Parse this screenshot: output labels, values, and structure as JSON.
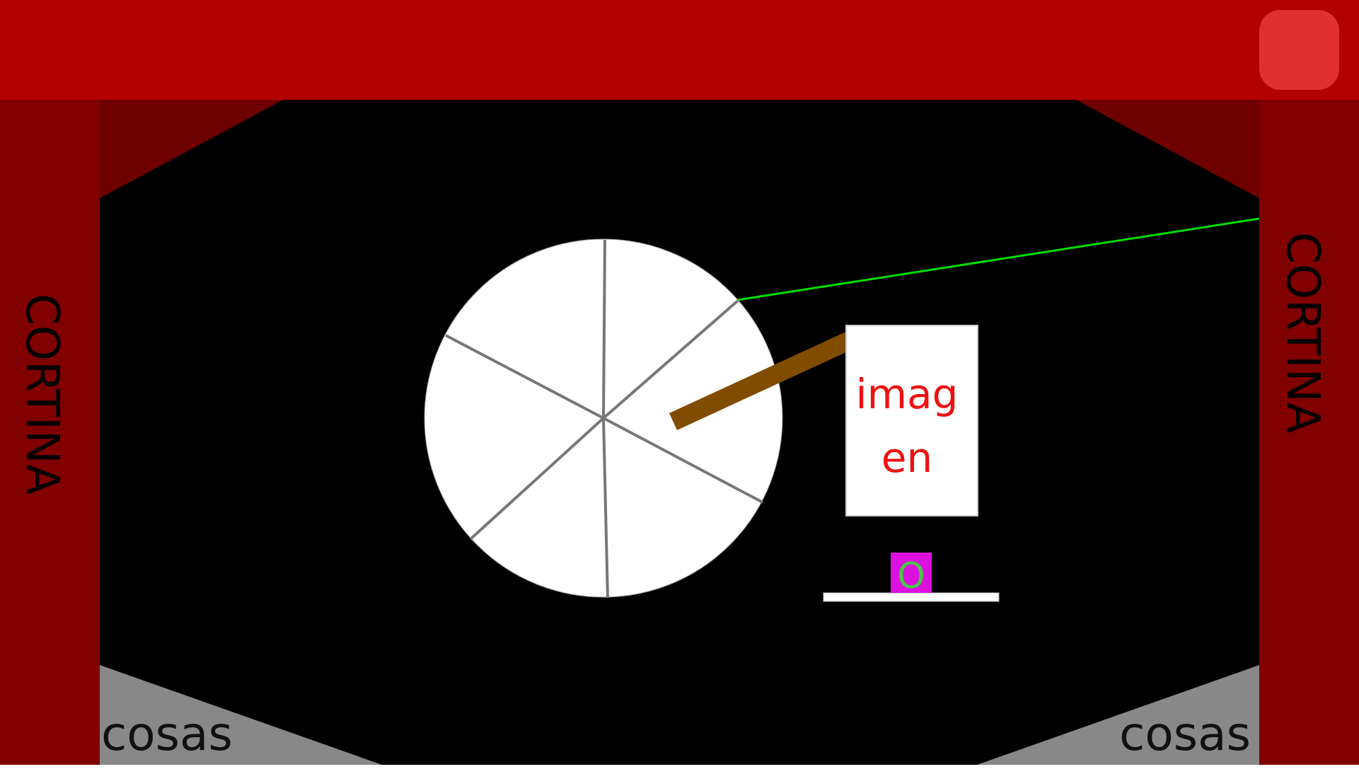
{
  "colors": {
    "top_bar": "#b30000",
    "curtain": "#800000",
    "curtain_top": "#700000",
    "stage_floor": "#000000",
    "floor_corner": "#888888",
    "wheel_fill": "#ffffff",
    "wheel_spokes": "#777777",
    "pointer": "#804d00",
    "laser": "#00dd00",
    "card_text": "#ee1111",
    "token_fill": "#dd11dd",
    "token_text": "#44cc44",
    "menu_button": "#e03030"
  },
  "curtains": {
    "left_label": "CORTINA",
    "right_label": "CORTINA"
  },
  "floor": {
    "left_label": "cosas",
    "right_label": "cosas"
  },
  "image_card": {
    "line1": "imag",
    "line2": "en"
  },
  "token": {
    "label": "O"
  },
  "wheel": {
    "segments": 6
  },
  "icons": {
    "menu": "rounded-square-button"
  }
}
